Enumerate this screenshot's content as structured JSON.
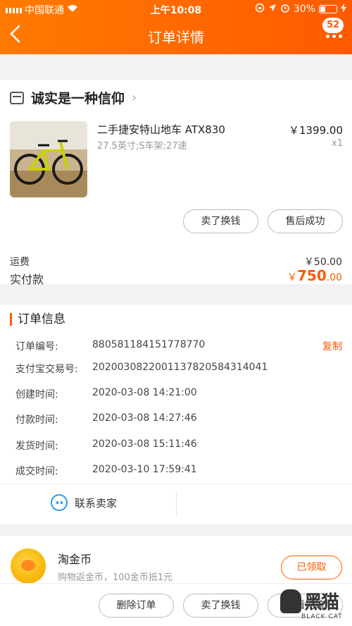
{
  "status_bar": {
    "carrier": "中国联通",
    "time": "上午10:08",
    "battery": "30%"
  },
  "nav": {
    "back_glyph": "〈",
    "title": "订单详情",
    "badge_count": "52"
  },
  "shop": {
    "name": "诚实是一种信仰",
    "chevron": "›"
  },
  "product": {
    "title": "二手捷安特山地车 ATX830",
    "spec": "27.5英寸;S车架;27速",
    "price": "￥1399.00",
    "qty": "x1"
  },
  "actions": {
    "resell": "卖了换钱",
    "after_sale": "售后成功"
  },
  "summary": {
    "shipping_label": "运费",
    "shipping_value": "￥50.00",
    "paid_label": "实付款",
    "paid_currency": "￥",
    "paid_integer": "750",
    "paid_decimal": ".00"
  },
  "order_info": {
    "title": "订单信息",
    "copy_label": "复制",
    "rows": [
      {
        "label": "订单编号:",
        "value": "880581184151778770"
      },
      {
        "label": "支付宝交易号:",
        "value": "2020030822001137820584314041"
      },
      {
        "label": "创建时间:",
        "value": "2020-03-08 14:21:00"
      },
      {
        "label": "付款时间:",
        "value": "2020-03-08 14:27:46"
      },
      {
        "label": "发货时间:",
        "value": "2020-03-08 15:11:46"
      },
      {
        "label": "成交时间:",
        "value": "2020-03-10 17:59:41"
      }
    ],
    "contact_label": "联系卖家"
  },
  "coins": {
    "title": "淘金币",
    "subtitle": "购物返金币，100金币抵1元",
    "claim_label": "已领取"
  },
  "bottom_bar": {
    "delete": "删除订单",
    "resell": "卖了换钱",
    "logistics": "查看物流"
  },
  "watermark": {
    "cn": "黑猫",
    "en": "BLACK CAT"
  },
  "colors": {
    "accent": "#ff5a00",
    "header_start": "#ff7a00",
    "link_blue": "#2b9bf0"
  }
}
